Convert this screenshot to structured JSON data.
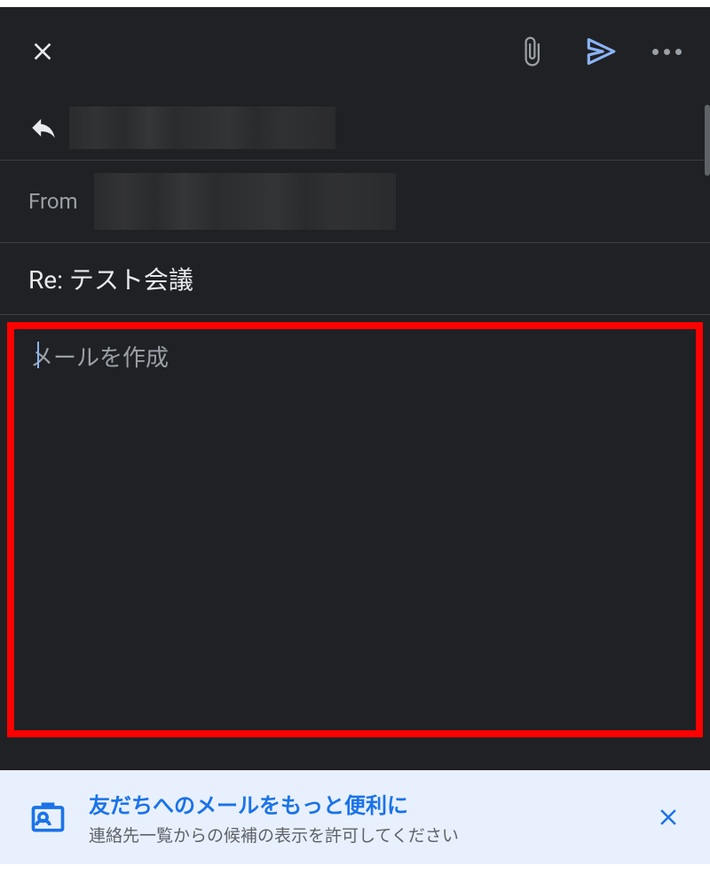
{
  "toolbar": {
    "close_icon": "close-icon",
    "attach_icon": "attach-icon",
    "send_icon": "send-icon",
    "more_icon": "more-icon"
  },
  "recipient": {
    "reply_icon": "reply-icon",
    "value_redacted": true
  },
  "from": {
    "label": "From",
    "value_redacted": true
  },
  "subject": {
    "text": "Re: テスト会議"
  },
  "body": {
    "placeholder": "メールを作成",
    "value": ""
  },
  "banner": {
    "icon": "contact-card-icon",
    "title": "友だちへのメールをもっと便利に",
    "subtitle": "連絡先一覧からの候補の表示を許可してください",
    "close_icon": "close-icon"
  },
  "colors": {
    "background": "#202124",
    "text_primary": "#e8eaed",
    "text_secondary": "#9aa0a6",
    "accent_blue": "#8ab4f8",
    "banner_bg": "#e8f0fe",
    "banner_title": "#1a73e8",
    "highlight_border": "#ff0000"
  }
}
